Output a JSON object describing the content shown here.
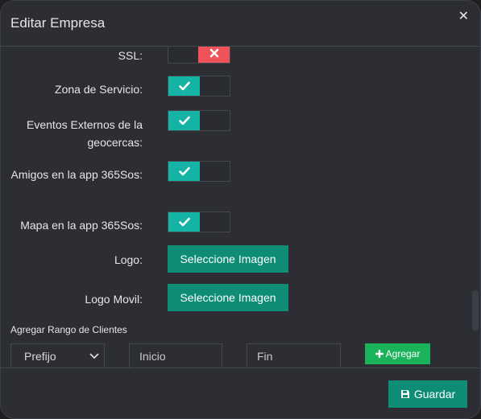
{
  "modal": {
    "title": "Editar Empresa",
    "close_icon": "close-icon"
  },
  "form": {
    "rows": [
      {
        "label": "SSL:",
        "state": "off"
      },
      {
        "label": "Zona de Servicio:",
        "state": "on"
      },
      {
        "label": "Eventos Externos de la geocercas:",
        "state": "on"
      },
      {
        "label": "Amigos en la app 365Sos:",
        "state": "on"
      },
      {
        "label": "Mapa en la app 365Sos:",
        "state": "on"
      }
    ],
    "logo": {
      "label": "Logo:",
      "button": "Seleccione Imagen"
    },
    "logo_movil": {
      "label": "Logo Movil:",
      "button": "Seleccione Imagen"
    },
    "range": {
      "title": "Agregar Rango de Clientes",
      "prefijo": "Prefijo",
      "inicio_placeholder": "Inicio",
      "fin_placeholder": "Fin",
      "add_button": "Agregar"
    }
  },
  "footer": {
    "save_button": "Guardar"
  },
  "colors": {
    "on": "#14b3a6",
    "off": "#f0525a",
    "primary": "#0e8c76",
    "success": "#1bb35a"
  }
}
